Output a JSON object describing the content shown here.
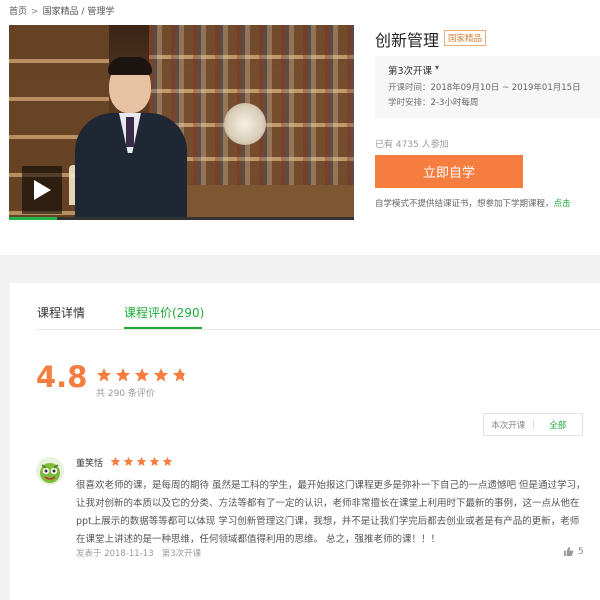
{
  "breadcrumb": {
    "home": "首页",
    "category": "国家精品 / 管理学",
    "separator": ">"
  },
  "course": {
    "title": "创新管理",
    "badge": "国家精品",
    "term": {
      "title": "第3次开课",
      "time_label": "开课时间：",
      "time_value": "2018年09月10日 ~ 2019年01月15日",
      "schedule_label": "学时安排：",
      "schedule_value": "2-3小时每周"
    },
    "enrolled_text": "已有 4735 人参加",
    "enroll_button": "立即自学",
    "self_note": "自学模式不提供结课证书，想参加下学期课程，",
    "self_note_link": "点击",
    "video_progress": 0.14
  },
  "tabs": [
    {
      "label": "课程详情",
      "active": false
    },
    {
      "label": "课程评价(290)",
      "active": true
    }
  ],
  "rating": {
    "score": "4.8",
    "stars": 4.8,
    "count_text": "共 290 条评价"
  },
  "filter": {
    "options": [
      "本次开课",
      "全部"
    ],
    "active": "全部"
  },
  "reviews": [
    {
      "author": "董笑恬",
      "stars": 5,
      "text": "很喜欢老师的课，是每周的期待 虽然是工科的学生，最开始报这门课程更多是弥补一下自己的一点遗憾吧 但是通过学习，让我对创新的本质以及它的分类、方法等都有了一定的认识，老师非常擅长在课堂上利用时下最新的事例，这一点从他在ppt上展示的数据等等都可以体现 学习创新管理这门课，我想，并不是让我们学完后都去创业或者是有产品的更新，老师在课堂上讲述的是一种思维，任何领域都值得利用的思维。 总之，强推老师的课！！！",
      "date": "发表于 2018-11-13",
      "term": "第3次开课",
      "likes": "5"
    }
  ],
  "colors": {
    "accent": "#1daa3a",
    "orange": "#f57d3f",
    "star": "#f57d3f"
  },
  "icons": {
    "play": "play-icon",
    "like": "thumbs-up-icon",
    "star": "star-icon"
  }
}
